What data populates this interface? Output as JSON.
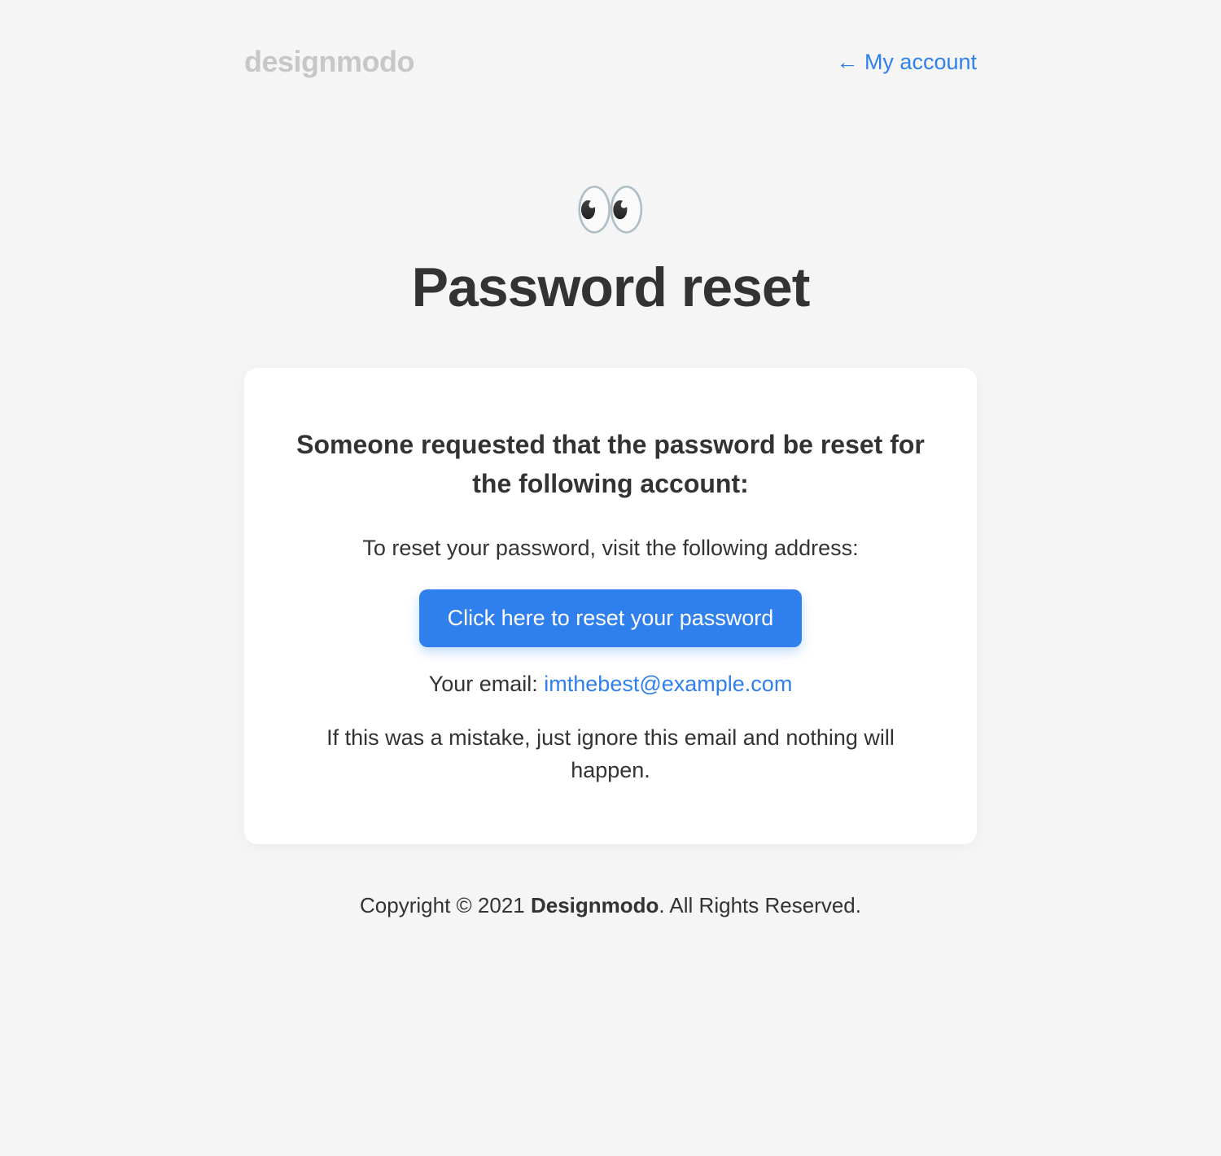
{
  "header": {
    "logo_text": "designmodo",
    "account_link": "← My account"
  },
  "hero": {
    "icon": "👀",
    "title": "Password reset"
  },
  "card": {
    "heading": "Someone requested that the password be reset for the following account:",
    "instruction": "To reset your password, visit the following address:",
    "button_label": "Click here to reset your password",
    "email_label": "Your email: ",
    "email_value": "imthebest@example.com",
    "mistake_note": "If this was a mistake, just ignore this email and nothing will happen."
  },
  "footer": {
    "copyright_prefix": "Copyright © 2021 ",
    "brand": "Designmodo",
    "copyright_suffix": ". All Rights Reserved."
  }
}
